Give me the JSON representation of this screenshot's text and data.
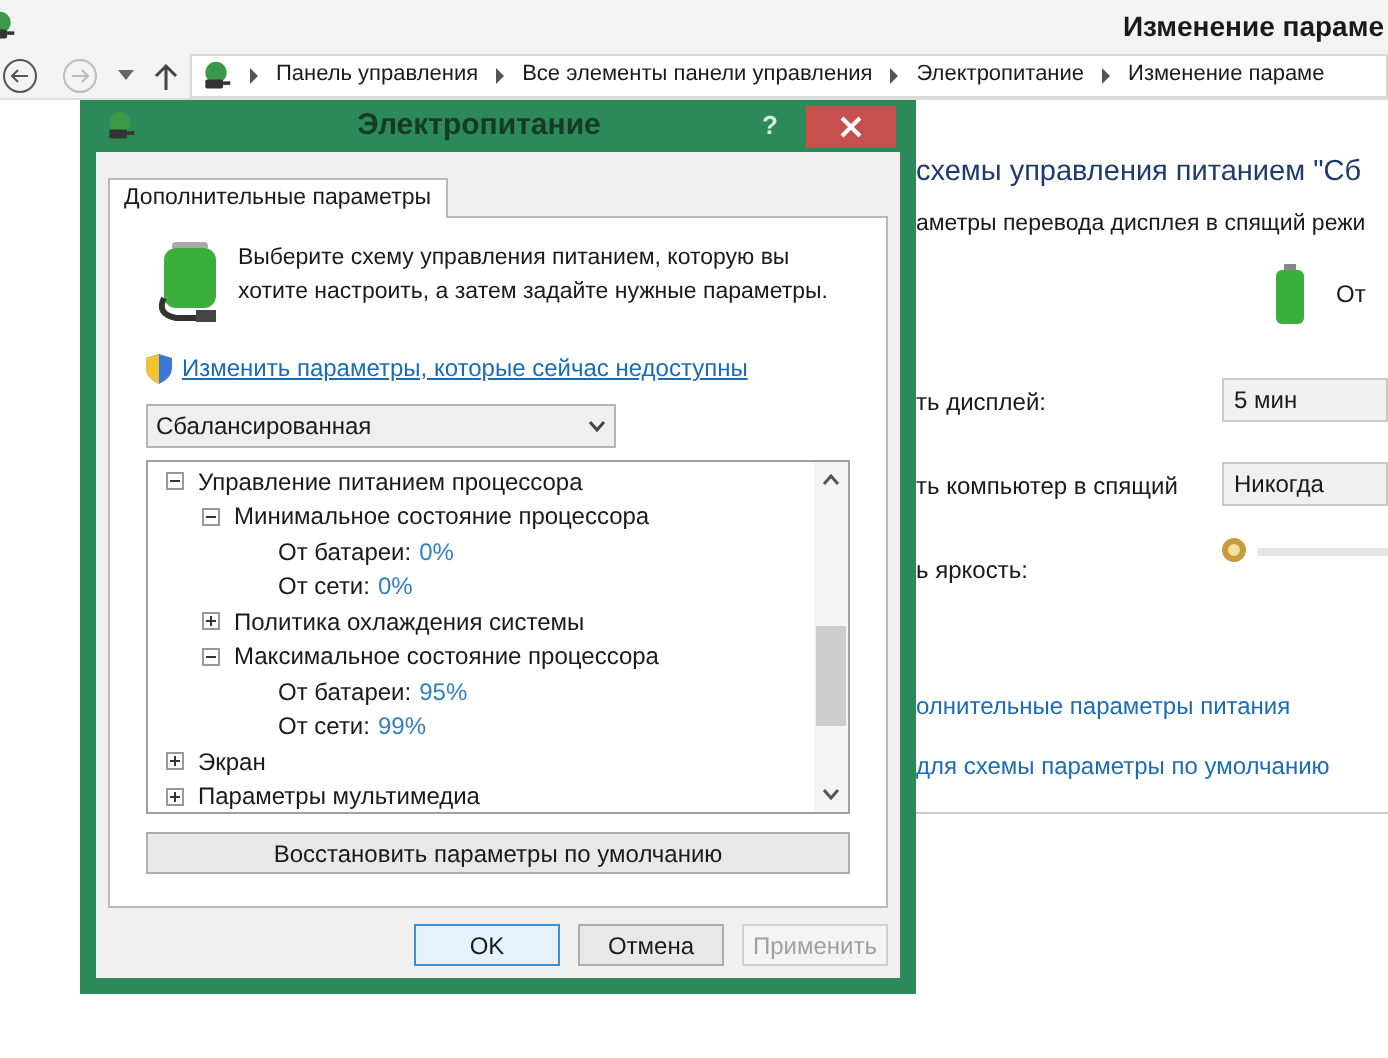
{
  "window": {
    "title": "Изменение параме"
  },
  "breadcrumbs": [
    "Панель управления",
    "Все элементы панели управления",
    "Электропитание",
    "Изменение параме"
  ],
  "plan_page": {
    "heading": "схемы управления питанием \"Сб",
    "subtitle": "аметры перевода дисплея в спящий режи",
    "column_header": "От",
    "settings": [
      {
        "kind": "dropdown",
        "label": "ть дисплей:",
        "value": "5 мин"
      },
      {
        "kind": "dropdown",
        "label": "ть компьютер в спящий",
        "value": "Никогда"
      },
      {
        "kind": "slider",
        "label": "ь яркость:",
        "level": 0
      }
    ],
    "links": [
      "олнительные параметры питания",
      "для схемы параметры по умолчанию"
    ]
  },
  "dialog": {
    "title": "Электропитание",
    "help": "?",
    "tabs": [
      {
        "label": "Дополнительные параметры",
        "selected": true
      }
    ],
    "intro": "Выберите схему управления питанием, которую вы хотите настроить, а затем задайте нужные параметры.",
    "admin_link": "Изменить параметры, которые сейчас недоступны",
    "plan": "Сбалансированная",
    "tree": [
      {
        "label": "Управление питанием процессора",
        "expanded": true,
        "children": [
          {
            "label": "Минимальное состояние процессора",
            "expanded": true,
            "children": [
              {
                "label": "От батареи:",
                "value": "0%"
              },
              {
                "label": "От сети:",
                "value": "0%"
              }
            ]
          },
          {
            "label": "Политика охлаждения системы",
            "expanded": false
          },
          {
            "label": "Максимальное состояние процессора",
            "expanded": true,
            "children": [
              {
                "label": "От батареи:",
                "value": "95%"
              },
              {
                "label": "От сети:",
                "value": "99%"
              }
            ]
          }
        ]
      },
      {
        "label": "Экран",
        "expanded": false
      },
      {
        "label": "Параметры мультимедиа",
        "expanded": false
      }
    ],
    "restore_button": "Восстановить параметры по умолчанию",
    "buttons": [
      {
        "label": "OK",
        "disabled": false,
        "default": true
      },
      {
        "label": "Отмена",
        "disabled": false,
        "default": false
      },
      {
        "label": "Применить",
        "disabled": true,
        "default": false
      }
    ]
  }
}
